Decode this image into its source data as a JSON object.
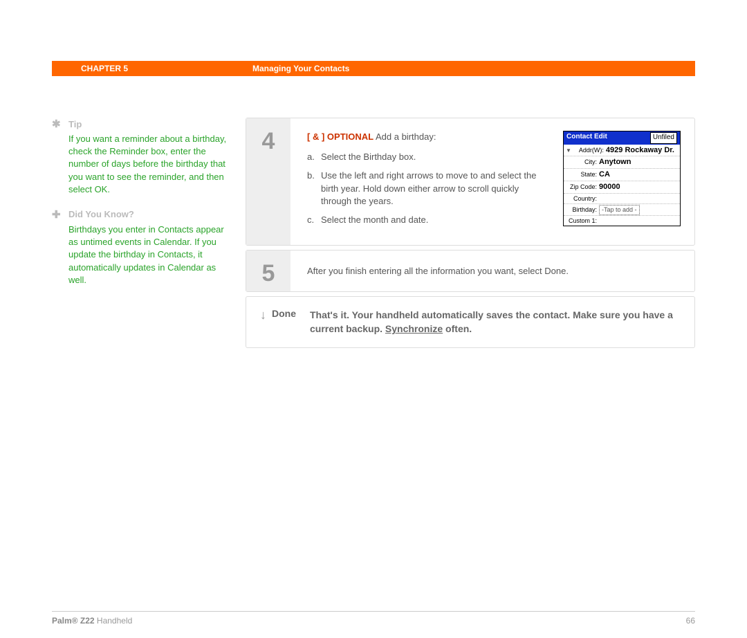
{
  "header": {
    "chapter": "CHAPTER 5",
    "title": "Managing Your Contacts"
  },
  "sidebar": {
    "tip": {
      "label": "Tip",
      "body": "If you want a reminder about a birthday, check the Reminder box, enter the number of days before the birthday that you want to see the reminder, and then select OK."
    },
    "dyk": {
      "label": "Did You Know?",
      "body": "Birthdays you enter in Contacts appear as untimed events in Calendar. If you update the birthday in Contacts, it automatically updates in Calendar as well."
    }
  },
  "steps": {
    "s4": {
      "num": "4",
      "opt_brackets": "[ & ]",
      "opt_word": "OPTIONAL",
      "opt_tail": "Add a birthday:",
      "a": "Select the Birthday box.",
      "b": "Use the left and right arrows to move to and select the birth year. Hold down either arrow to scroll quickly through the years.",
      "c": "Select the month and date."
    },
    "s5": {
      "num": "5",
      "body": "After you finish entering all the information you want, select Done."
    }
  },
  "done": {
    "label": "Done",
    "text_a": "That's it. Your handheld automatically saves the contact. Make sure you have a current backup. ",
    "link": "Synchronize",
    "text_b": " often."
  },
  "screenshot": {
    "title": "Contact Edit",
    "category": "Unfiled",
    "rows": {
      "addr_label": "Addr(W):",
      "addr_val": "4929 Rockaway Dr.",
      "city_label": "City:",
      "city_val": "Anytown",
      "state_label": "State:",
      "state_val": "CA",
      "zip_label": "Zip Code:",
      "zip_val": "90000",
      "country_label": "Country:",
      "birthday_label": "Birthday:",
      "birthday_val": "-Tap to add -",
      "custom_label": "Custom 1:"
    }
  },
  "footer": {
    "brand": "Palm®",
    "model": "Z22",
    "suffix": "Handheld",
    "page": "66"
  }
}
